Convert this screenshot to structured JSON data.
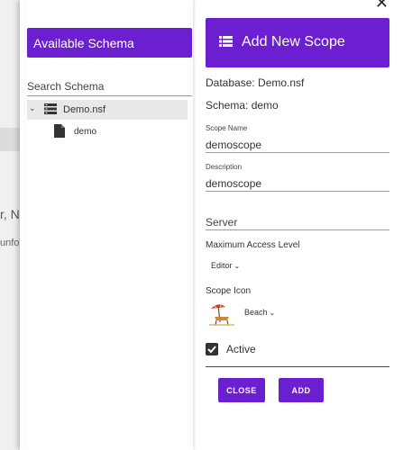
{
  "background": {
    "fragment_1": "r, N",
    "fragment_2": "unfo"
  },
  "drawer": {
    "close_glyph": "✕"
  },
  "left_panel": {
    "title": "Available Schema",
    "search_placeholder": "Search Schema",
    "tree": {
      "toggle_glyph": "⌄",
      "database": {
        "label": "Demo.nsf",
        "icon": "database-icon"
      },
      "schemas": [
        {
          "label": "demo",
          "icon": "document-icon"
        }
      ]
    }
  },
  "right_panel": {
    "title": "Add New Scope",
    "title_icon": "list-icon",
    "database_line": "Database: Demo.nsf",
    "schema_line": "Schema: demo",
    "scope_name": {
      "label": "Scope Name",
      "value": "demoscope"
    },
    "description": {
      "label": "Description",
      "value": "demoscope"
    },
    "server": {
      "placeholder": "Server",
      "value": ""
    },
    "max_access": {
      "label": "Maximum Access Level",
      "value": "Editor"
    },
    "scope_icon": {
      "label": "Scope Icon",
      "value": "Beach",
      "icon": "beach-icon"
    },
    "active": {
      "label": "Active",
      "checked": true
    },
    "buttons": {
      "close": "CLOSE",
      "add": "ADD"
    }
  },
  "colors": {
    "accent": "#6b1fd0",
    "tree_selected": "#e8e8e8"
  }
}
